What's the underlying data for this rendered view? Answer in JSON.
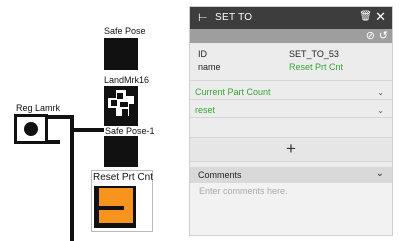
{
  "canvas": {
    "nodes": {
      "safe_pose": "Safe Pose",
      "landmark": "LandMrk16",
      "reg_landmark": "Reg Lamrk",
      "safe_pose_1": "Safe Pose-1",
      "reset_part": "Reset Prt Cnt"
    },
    "colors": {
      "accent_block": "#f7941d",
      "node": "#111111"
    }
  },
  "panel": {
    "title": "SET TO",
    "icons": {
      "flag": "flag-icon",
      "trash": "trash-icon",
      "close": "close-icon",
      "disable": "disable-icon",
      "refresh": "refresh-icon"
    },
    "properties": [
      {
        "key": "ID",
        "value": "SET_TO_53"
      },
      {
        "key": "name",
        "value": "Reset Prt Cnt"
      }
    ],
    "dropdown_variable": "Current Part Count",
    "dropdown_value": "reset",
    "add_symbol": "+",
    "comments_label": "Comments",
    "comments_placeholder": "Enter comments here."
  }
}
